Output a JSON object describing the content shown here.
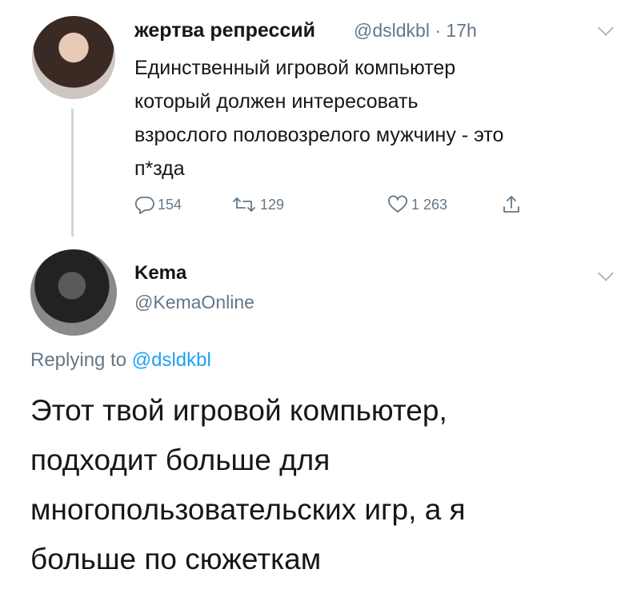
{
  "tweet": {
    "author_name": "жертва репрессий",
    "author_handle": "@dsldkbl",
    "separator": "·",
    "time": "17h",
    "text_lines": [
      "Единственный игровой компьютер",
      "который должен интересовать",
      "взрослого половозрелого мужчину - это",
      "п*зда"
    ],
    "reply_count": "154",
    "retweet_count": "129",
    "like_count": "1 263",
    "icons": [
      "reply-icon",
      "retweet-icon",
      "like-icon",
      "share-icon",
      "chevron-down-icon"
    ]
  },
  "reply": {
    "author_name": "Kema",
    "author_handle": "@KemaOnline",
    "replying_prefix": "Replying to",
    "replying_handle": "@dsldkbl",
    "text_lines": [
      "Этот твой игровой компьютер,",
      "подходит больше для",
      "многопользовательских игр, а я",
      "больше по сюжеткам"
    ]
  },
  "colors": {
    "text": "#14171a",
    "secondary": "#657786",
    "link": "#1da1f2",
    "thread_line": "#ccd6dd"
  }
}
